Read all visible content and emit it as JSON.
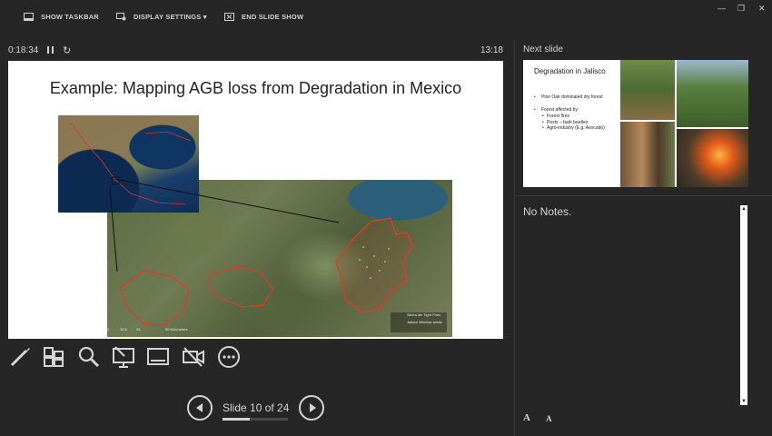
{
  "toolbar": {
    "show_taskbar": "SHOW TASKBAR",
    "display_settings": "DISPLAY SETTINGS ▾",
    "end_slide_show": "END SLIDE SHOW"
  },
  "window_controls": {
    "minimize": "—",
    "restore": "❐",
    "close": "✕"
  },
  "timer": {
    "elapsed": "0:18:34",
    "clock": "13:18"
  },
  "current_slide": {
    "title": "Example: Mapping AGB loss from Degradation in Mexico",
    "scale_labels": [
      "0",
      "12.5",
      "25",
      "50 Kilometers"
    ],
    "legend": [
      "Sierra del Tigre Fires",
      "Jalisco Window areas"
    ]
  },
  "next_slide": {
    "label": "Next slide",
    "title": "Degradation in Jalisco",
    "bullet1": "Pine Oak dominated dry forest",
    "bullet2": "Forest affected by:",
    "sub_bullets": [
      "Forest fires",
      "Pests – bark beetles",
      "Agro-industry (E.g. Avocado)"
    ]
  },
  "notes": {
    "text": "No Notes."
  },
  "font_controls": {
    "increase": "A",
    "decrease": "A"
  },
  "navigation": {
    "slide_label": "Slide 10 of 24",
    "current": 10,
    "total": 24
  },
  "tools": [
    "pen-icon",
    "see-all-slides-icon",
    "zoom-icon",
    "pointer-screen-icon",
    "black-screen-icon",
    "camera-off-icon",
    "more-options-icon"
  ]
}
